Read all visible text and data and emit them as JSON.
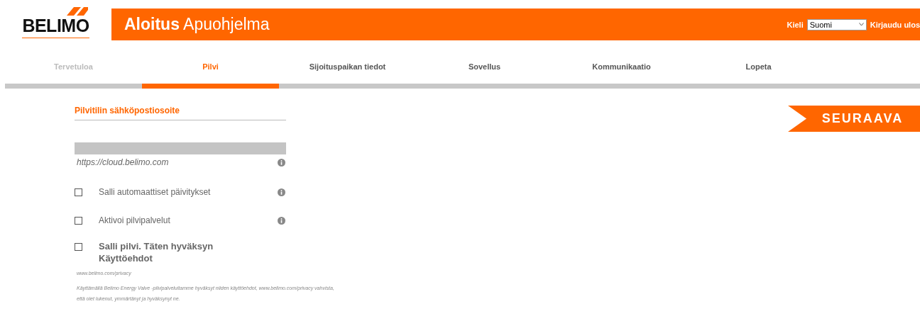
{
  "header": {
    "logo": "BELIMO",
    "title_bold": "Aloitus",
    "title": "Apuohjelma",
    "language_label": "Kieli",
    "language": "Suomi",
    "logout": "Kirjaudu ulos"
  },
  "steps": [
    {
      "label": "Tervetuloa",
      "selected": false,
      "done": true
    },
    {
      "label": "Pilvi",
      "selected": true,
      "done": false
    },
    {
      "label": "Sijoituspaikan tiedot",
      "selected": false,
      "done": false
    },
    {
      "label": "Sovellus",
      "selected": false,
      "done": false
    },
    {
      "label": "Kommunikaatio",
      "selected": false,
      "done": false
    },
    {
      "label": "Lopeta",
      "selected": false,
      "done": false
    }
  ],
  "email": {
    "label": "Pilvitilin sähköpostiosoite",
    "disabled": true
  },
  "url": "https://cloud.belimo.com",
  "options": [
    {
      "label": "Salli automaattiset päivitykset",
      "checked": false,
      "kind": "info"
    },
    {
      "label": "Aktivoi pilvipalvelut",
      "checked": false,
      "kind": "info"
    },
    {
      "label": "Salli pilvi. Täten hyväksyn Käyttöehdot",
      "checked": false,
      "kind": "terms"
    }
  ],
  "privacy_link": "www.belimo.com/privacy",
  "terms_text": "Käyttämällä Belimo Energy Valve -pilvipalveluitamme hyväksyt niiden käyttöehdot, www.belimo.com/privacy vahvista, että olet lukenut, ymmärtänyt ja hyväksynyt ne.",
  "next_button": "SEURAAVA"
}
